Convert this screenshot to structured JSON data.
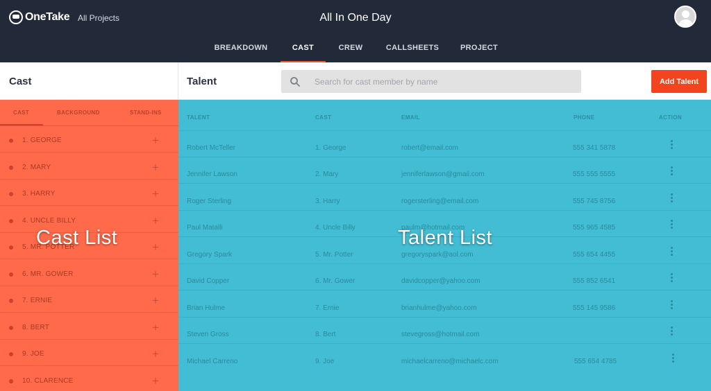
{
  "header": {
    "logo_text": "OneTake",
    "all_projects": "All Projects",
    "title": "All In One Day"
  },
  "nav": [
    {
      "label": "BREAKDOWN",
      "active": false
    },
    {
      "label": "CAST",
      "active": true
    },
    {
      "label": "CREW",
      "active": false
    },
    {
      "label": "CALLSHEETS",
      "active": false
    },
    {
      "label": "PROJECT",
      "active": false
    }
  ],
  "cast_panel": {
    "title": "Cast",
    "tabs": [
      "CAST",
      "BACKGROUND",
      "STAND-INS"
    ],
    "items": [
      "1. GEORGE",
      "2. MARY",
      "3. HARRY",
      "4. UNCLE BILLY",
      "5. MR. POTTER",
      "6. MR. GOWER",
      "7. ERNIE",
      "8. BERT",
      "9. JOE",
      "10. CLARENCE"
    ],
    "overlay_label": "Cast List"
  },
  "talent_panel": {
    "title": "Talent",
    "search_placeholder": "Search for cast member by name",
    "add_button": "Add Talent",
    "columns": [
      "TALENT",
      "CAST",
      "EMAIL",
      "PHONE",
      "ACTION"
    ],
    "rows": [
      {
        "talent": "Robert McTeller",
        "cast": "1. George",
        "email": "robert@email.com",
        "phone": "555 341 5878"
      },
      {
        "talent": "Jennifer Lawson",
        "cast": "2. Mary",
        "email": "jenniferlawson@gmail.com",
        "phone": "555 555 5555"
      },
      {
        "talent": "Roger Sterling",
        "cast": "3. Harry",
        "email": "rogersterling@email.com",
        "phone": "555 745 8756"
      },
      {
        "talent": "Paul Matalli",
        "cast": "4. Uncle Billy",
        "email": "paulm@hotmail.com",
        "phone": "555 965 4585"
      },
      {
        "talent": "Gregory Spark",
        "cast": "5. Mr. Potter",
        "email": "gregoryspark@aol.com",
        "phone": "555 654 4455"
      },
      {
        "talent": "David Copper",
        "cast": "6. Mr. Gower",
        "email": "davidcopper@yahoo.com",
        "phone": "555 852 6541"
      },
      {
        "talent": "Brian Hulme",
        "cast": "7. Ernie",
        "email": "brianhulme@yahoo.com",
        "phone": "555 145 9586"
      },
      {
        "talent": "Steven Gross",
        "cast": "8. Bert",
        "email": "stevegross@hotmail.com",
        "phone": ""
      },
      {
        "talent": "Michael Carreno",
        "cast": "9. Joe",
        "email": "michaelcarreno@michaelc.com",
        "phone": "555 654 4785"
      }
    ],
    "overlay_label": "Talent List"
  },
  "colors": {
    "topbar": "#222a3a",
    "cast_panel": "#ff6a4a",
    "talent_panel": "#43bdd3",
    "accent": "#f2451f"
  }
}
